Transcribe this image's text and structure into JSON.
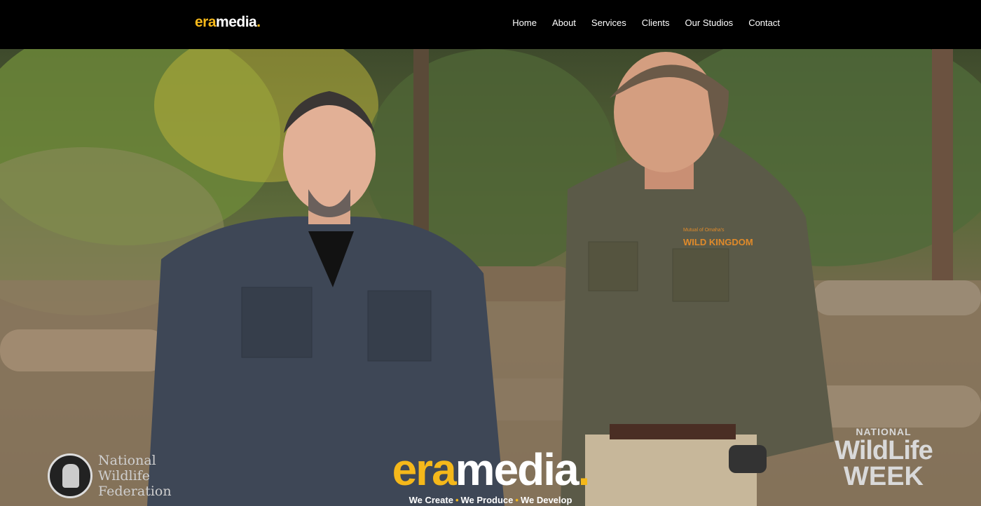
{
  "header": {
    "logo_prefix": "era",
    "logo_suffix": "media",
    "logo_dot": ".",
    "nav": [
      "Home",
      "About",
      "Services",
      "Clients",
      "Our Studios",
      "Contact"
    ]
  },
  "hero": {
    "center_logo_prefix": "era",
    "center_logo_suffix": "media",
    "center_logo_dot": ".",
    "tagline": [
      "We Create",
      "We Produce",
      "We Develop"
    ],
    "tagline_separator": "•",
    "left_badge_lines": [
      "National",
      "Wildlife",
      "Federation"
    ],
    "right_badge": {
      "top": "NATIONAL",
      "middle": "WildLife",
      "bottom": "WEEK"
    },
    "shirt_patch": [
      "Mutual of Omaha's",
      "WILD KINGDOM"
    ]
  },
  "colors": {
    "accent": "#f5b81a",
    "topbar": "#000000"
  }
}
